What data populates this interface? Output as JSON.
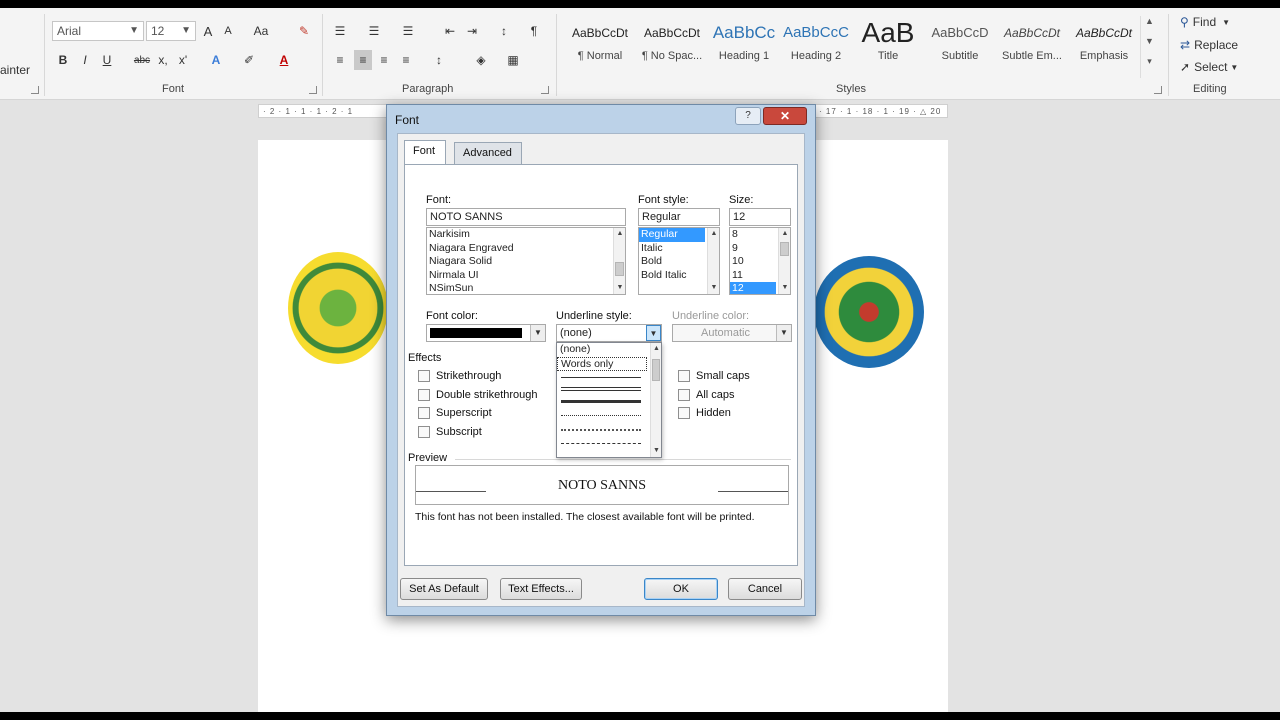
{
  "ribbon": {
    "clipboard": {
      "format_painter": "ainter"
    },
    "font": {
      "group_label": "Font",
      "font_name": "Arial",
      "font_size": "12",
      "grow": "A",
      "shrink": "A",
      "change_case": "Aa",
      "bold": "B",
      "italic": "I",
      "underline": "U",
      "strikethrough": "abc",
      "subscript": "x,",
      "superscript": "x'"
    },
    "paragraph": {
      "group_label": "Paragraph",
      "pilcrow": "¶"
    },
    "styles": {
      "group_label": "Styles",
      "items": [
        {
          "sample": "AaBbCcDt",
          "name": "¶ Normal"
        },
        {
          "sample": "AaBbCcDt",
          "name": "¶ No Spac..."
        },
        {
          "sample": "AaBbCc",
          "name": "Heading 1"
        },
        {
          "sample": "AaBbCcC",
          "name": "Heading 2"
        },
        {
          "sample": "AaB",
          "name": "Title"
        },
        {
          "sample": "AaBbCcD",
          "name": "Subtitle"
        },
        {
          "sample": "AaBbCcDt",
          "name": "Subtle Em..."
        },
        {
          "sample": "AaBbCcDt",
          "name": "Emphasis"
        }
      ]
    },
    "editing": {
      "group_label": "Editing",
      "find": "Find",
      "replace": "Replace",
      "select": "Select"
    }
  },
  "ruler": {
    "left": "· 2 · 1 · 1 · 1 · 2 · 1",
    "right": "· 17 · 1 · 18 · 1 · 19 · △ 20"
  },
  "dialog": {
    "title": "Font",
    "help": "?",
    "close": "✕",
    "tabs": [
      {
        "label": "Font"
      },
      {
        "label": "Advanced"
      }
    ],
    "font": {
      "label": "Font:",
      "value": "NOTO SANNS",
      "list": [
        "Narkisim",
        "Niagara Engraved",
        "Niagara Solid",
        "Nirmala UI",
        "NSimSun"
      ]
    },
    "font_style": {
      "label": "Font style:",
      "value": "Regular",
      "list": [
        "Regular",
        "Italic",
        "Bold",
        "Bold Italic"
      ],
      "selected": "Regular"
    },
    "size": {
      "label": "Size:",
      "value": "12",
      "list": [
        "8",
        "9",
        "10",
        "11",
        "12"
      ],
      "selected": "12"
    },
    "font_color": {
      "label": "Font color:",
      "color": "#000000"
    },
    "underline_style": {
      "label": "Underline style:",
      "value": "(none)",
      "options": [
        "(none)",
        "Words only"
      ]
    },
    "underline_color": {
      "label": "Underline color:",
      "value": "Automatic"
    },
    "effects": {
      "label": "Effects",
      "left": [
        "Strikethrough",
        "Double strikethrough",
        "Superscript",
        "Subscript"
      ],
      "right": [
        "Small caps",
        "All caps",
        "Hidden"
      ]
    },
    "preview": {
      "label": "Preview",
      "text": "NOTO SANNS",
      "note": "This font has not been installed. The closest available font will be printed."
    },
    "buttons": {
      "set_default": "Set As Default",
      "text_effects": "Text Effects...",
      "ok": "OK",
      "cancel": "Cancel"
    }
  },
  "colors": {
    "selection": "#3399ff",
    "close_button": "#c9483c",
    "dialog_frame": "#bcd2e8"
  }
}
